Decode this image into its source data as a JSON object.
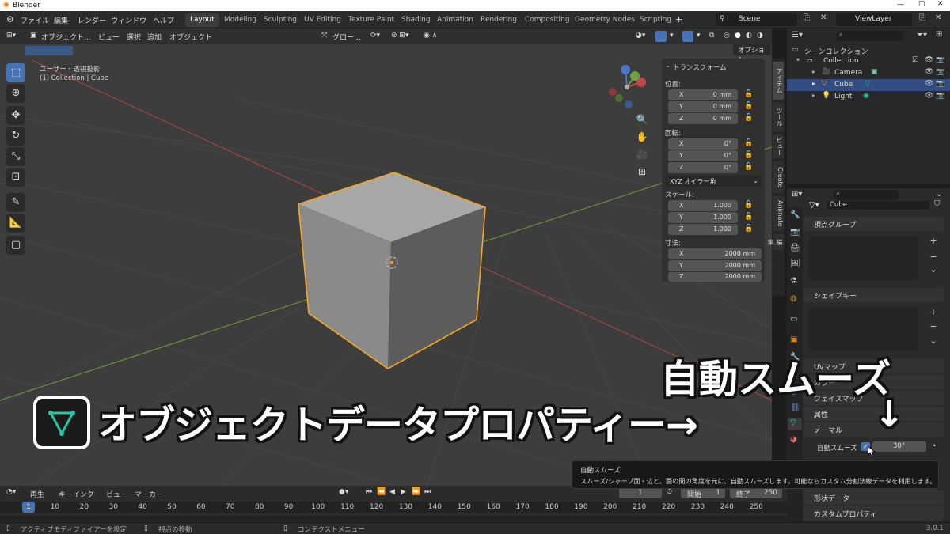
{
  "app": {
    "title": "Blender",
    "version": "3.0.1"
  },
  "menu": {
    "items": [
      "ファイル",
      "編集",
      "レンダー",
      "ウィンドウ",
      "ヘルプ"
    ]
  },
  "workspaces": [
    "Layout",
    "Modeling",
    "Sculpting",
    "UV Editing",
    "Texture Paint",
    "Shading",
    "Animation",
    "Rendering",
    "Compositing",
    "Geometry Nodes",
    "Scripting"
  ],
  "workspace_add": "+",
  "scene": {
    "name": "Scene",
    "view_layer": "ViewLayer"
  },
  "viewport_header": {
    "mode": "オブジェクト...",
    "menus": [
      "ビュー",
      "選択",
      "追加",
      "オブジェクト"
    ],
    "transform_orientation": "グロー...",
    "options": "オプション"
  },
  "viewport_info": {
    "view_name": "ユーザー・透視投影",
    "collection_info": "(1) Collection | Cube"
  },
  "npanel": {
    "section_title": "トランスフォーム",
    "location_label": "位置:",
    "location": [
      {
        "axis": "X",
        "value": "0 mm"
      },
      {
        "axis": "Y",
        "value": "0 mm"
      },
      {
        "axis": "Z",
        "value": "0 mm"
      }
    ],
    "rotation_label": "回転:",
    "rotation": [
      {
        "axis": "X",
        "value": "0°"
      },
      {
        "axis": "Y",
        "value": "0°"
      },
      {
        "axis": "Z",
        "value": "0°"
      }
    ],
    "rotation_mode": "XYZ オイラー角",
    "scale_label": "スケール:",
    "scale": [
      {
        "axis": "X",
        "value": "1.000"
      },
      {
        "axis": "Y",
        "value": "1.000"
      },
      {
        "axis": "Z",
        "value": "1.000"
      }
    ],
    "dimensions_label": "寸法:",
    "dimensions": [
      {
        "axis": "X",
        "value": "2000 mm"
      },
      {
        "axis": "Y",
        "value": "2000 mm"
      },
      {
        "axis": "Z",
        "value": "2000 mm"
      }
    ]
  },
  "side_tabs": [
    "アイテム",
    "ツール",
    "ビュー",
    "Create",
    "Animate",
    "編集"
  ],
  "outliner": {
    "root": "シーンコレクション",
    "collection": "Collection",
    "objects": [
      "Camera",
      "Cube",
      "Light"
    ],
    "selected": "Cube"
  },
  "properties": {
    "object_name": "Cube",
    "panels": {
      "vertex_groups": "頂点グループ",
      "shape_keys": "シェイプキー",
      "uv_maps": "UVマップ",
      "vertex_colors": "カラー",
      "face_maps": "フェイスマップ",
      "attributes": "属性",
      "normals": "ノーマル",
      "texture_space": "形状データ",
      "custom_props": "カスタムプロパティ"
    },
    "auto_smooth_label": "自動スムーズ",
    "auto_smooth_checked": true,
    "auto_smooth_angle": "30°"
  },
  "tooltip": {
    "title": "自動スムーズ",
    "body": "スムーズ/シャープ面・辺と、面の間の角度を元に、自動スムーズします。可能ならカスタム分割法線データを利用します。"
  },
  "timeline": {
    "menus": [
      "再生",
      "キーイング",
      "ビュー",
      "マーカー"
    ],
    "current_frame": "1",
    "start_label": "開始",
    "start": "1",
    "end_label": "終了",
    "end": "250",
    "ruler": [
      "1",
      "10",
      "20",
      "30",
      "40",
      "50",
      "60",
      "70",
      "80",
      "90",
      "100",
      "110",
      "120",
      "130",
      "140",
      "150",
      "160",
      "170",
      "180",
      "190",
      "200",
      "210",
      "220",
      "230",
      "240",
      "250"
    ]
  },
  "statusbar": {
    "left": "アクティブモディファイアーを設定",
    "middle": "視点の移動",
    "right": "コンテクストメニュー"
  },
  "overlay": {
    "caption_main": "オブジェクトデータプロパティー→",
    "caption_top": "自動スムーズ",
    "arrow": "↓"
  },
  "colors": {
    "accent": "#4772b3",
    "selection_orange": "#f5a623",
    "data_icon_green": "#26c6a6"
  }
}
